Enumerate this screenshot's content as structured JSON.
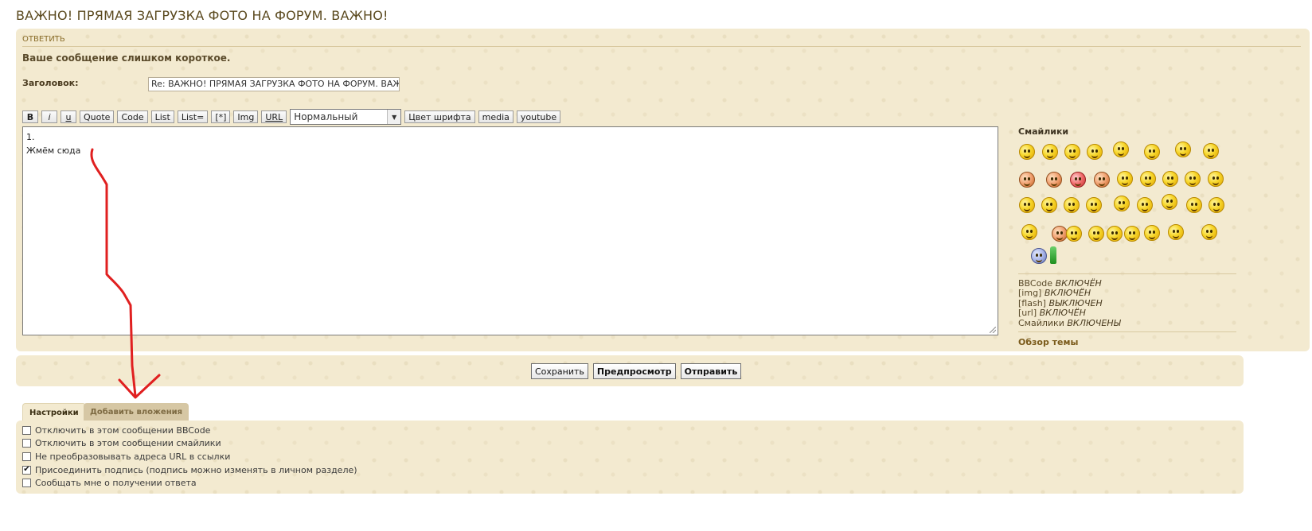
{
  "page": {
    "title": "ВАЖНО! ПРЯМАЯ ЗАГРУЗКА ФОТО НА ФОРУМ. ВАЖНО!"
  },
  "reply": {
    "heading": "ОТВЕТИТЬ",
    "error": "Ваше сообщение слишком короткое.",
    "subject_label": "Заголовок:",
    "subject_value": "Re: ВАЖНО! ПРЯМАЯ ЗАГРУЗКА ФОТО НА ФОРУМ. ВАЖНО!"
  },
  "toolbar": {
    "buttons": [
      "B",
      "i",
      "u",
      "Quote",
      "Code",
      "List",
      "List=",
      "[*]",
      "Img",
      "URL"
    ],
    "size_selected": "Нормальный",
    "font_color": "Цвет шрифта",
    "media": "media",
    "youtube": "youtube"
  },
  "editor": {
    "lines": [
      "1.",
      "Жмём сюда"
    ]
  },
  "sidebar": {
    "smilies_title": "Смайлики",
    "status": [
      {
        "label": "BBCode",
        "value": "ВКЛЮЧЁН"
      },
      {
        "label": "[img]",
        "value": "ВКЛЮЧЁН"
      },
      {
        "label": "[flash]",
        "value": "ВЫКЛЮЧЕН"
      },
      {
        "label": "[url]",
        "value": "ВКЛЮЧЁН"
      },
      {
        "label": "Смайлики",
        "value": "ВКЛЮЧЕНЫ"
      }
    ],
    "review_link": "Обзор темы"
  },
  "actions": {
    "save": "Сохранить",
    "preview": "Предпросмотр",
    "submit": "Отправить"
  },
  "tabs": {
    "settings": "Настройки",
    "attachments": "Добавить вложения"
  },
  "options": [
    {
      "label": "Отключить в этом сообщении BBCode",
      "checked": false
    },
    {
      "label": "Отключить в этом сообщении смайлики",
      "checked": false
    },
    {
      "label": "Не преобразовывать адреса URL в ссылки",
      "checked": false
    },
    {
      "label": "Присоединить подпись (подпись можно изменять в личном разделе)",
      "checked": true
    },
    {
      "label": "Сообщать мне о получении ответа",
      "checked": false
    }
  ],
  "colors": {
    "panel_bg": "#f3ead0",
    "title": "#5b4a1f",
    "annotation_arrow": "#e02020"
  }
}
